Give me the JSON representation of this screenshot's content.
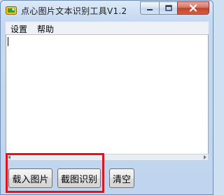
{
  "window": {
    "title": "点心图片文本识别工具V1.2",
    "controls": [
      "minimize",
      "maximize",
      "close"
    ],
    "colors": {
      "close_button": "#c2432d"
    }
  },
  "menu": {
    "items": [
      {
        "id": "settings",
        "label": "设置"
      },
      {
        "id": "help",
        "label": "帮助"
      }
    ]
  },
  "output": {
    "value": ""
  },
  "buttons": {
    "load_image": "载入图片",
    "capture_recognize": "截图识别",
    "clear": "清空"
  },
  "annotation": {
    "color": "#e0141e"
  },
  "icons": {
    "app": "app-icon",
    "minimize": "minimize-icon",
    "maximize": "maximize-icon",
    "close": "close-icon"
  }
}
